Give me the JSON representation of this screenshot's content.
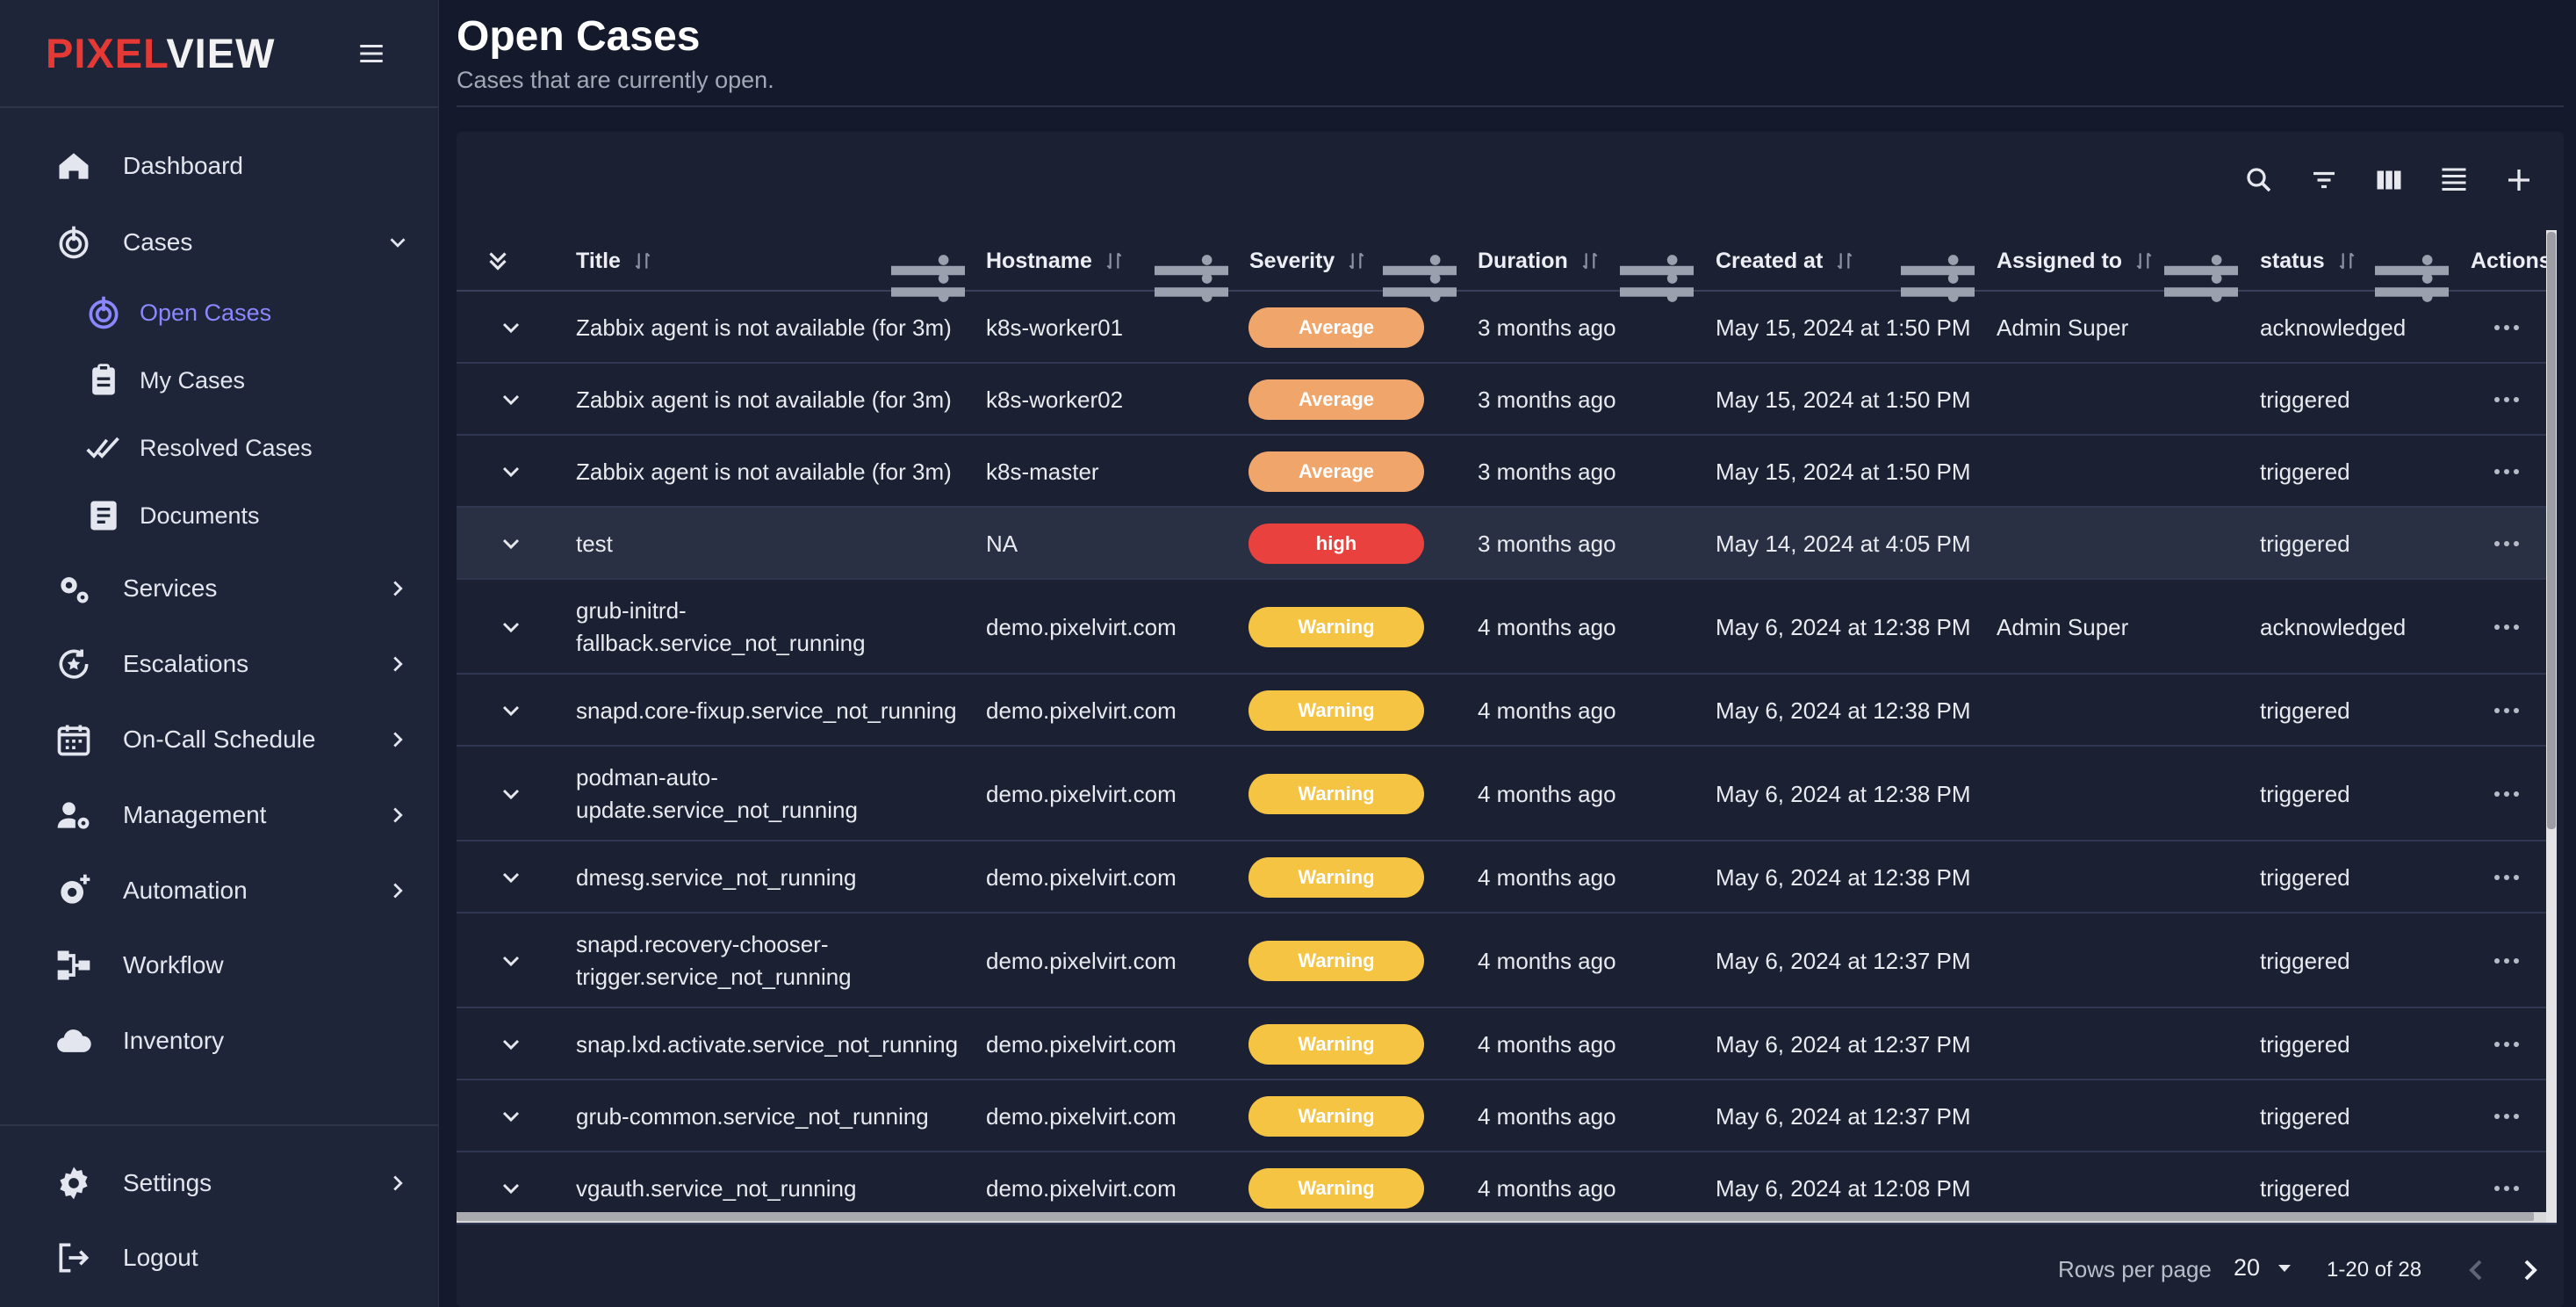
{
  "brand": {
    "part1": "PIXEL",
    "part2": "VIEW"
  },
  "sidebar": {
    "items": [
      {
        "label": "Dashboard",
        "icon": "home-icon"
      },
      {
        "label": "Cases",
        "icon": "target-icon"
      },
      {
        "label": "Services",
        "icon": "gears-icon"
      },
      {
        "label": "Escalations",
        "icon": "escalation-icon"
      },
      {
        "label": "On-Call Schedule",
        "icon": "calendar-icon"
      },
      {
        "label": "Management",
        "icon": "user-gear-icon"
      },
      {
        "label": "Automation",
        "icon": "gear-plus-icon"
      },
      {
        "label": "Workflow",
        "icon": "workflow-icon"
      },
      {
        "label": "Inventory",
        "icon": "cloud-icon"
      }
    ],
    "cases_sub": [
      {
        "label": "Open Cases",
        "icon": "target-icon",
        "active": true
      },
      {
        "label": "My Cases",
        "icon": "clipboard-icon"
      },
      {
        "label": "Resolved Cases",
        "icon": "double-check-icon"
      },
      {
        "label": "Documents",
        "icon": "document-icon"
      }
    ],
    "bottom": [
      {
        "label": "Settings",
        "icon": "gear-icon"
      },
      {
        "label": "Logout",
        "icon": "logout-icon"
      }
    ]
  },
  "header": {
    "title": "Open Cases",
    "subtitle": "Cases that are currently open."
  },
  "table": {
    "columns": [
      "Title",
      "Hostname",
      "Severity",
      "Duration",
      "Created at",
      "Assigned to",
      "status",
      "Actions"
    ],
    "rows": [
      {
        "title": "Zabbix agent is not available (for 3m)",
        "hostname": "k8s-worker01",
        "severity": "Average",
        "duration": "3 months ago",
        "created": "May 15, 2024 at 1:50 PM",
        "assigned": "Admin Super",
        "status": "acknowledged"
      },
      {
        "title": "Zabbix agent is not available (for 3m)",
        "hostname": "k8s-worker02",
        "severity": "Average",
        "duration": "3 months ago",
        "created": "May 15, 2024 at 1:50 PM",
        "assigned": "",
        "status": "triggered"
      },
      {
        "title": "Zabbix agent is not available (for 3m)",
        "hostname": "k8s-master",
        "severity": "Average",
        "duration": "3 months ago",
        "created": "May 15, 2024 at 1:50 PM",
        "assigned": "",
        "status": "triggered"
      },
      {
        "title": "test",
        "hostname": "NA",
        "severity": "high",
        "duration": "3 months ago",
        "created": "May 14, 2024 at 4:05 PM",
        "assigned": "",
        "status": "triggered"
      },
      {
        "title": "grub-initrd-fallback.service_not_running",
        "hostname": "demo.pixelvirt.com",
        "severity": "Warning",
        "duration": "4 months ago",
        "created": "May 6, 2024 at 12:38 PM",
        "assigned": "Admin Super",
        "status": "acknowledged"
      },
      {
        "title": "snapd.core-fixup.service_not_running",
        "hostname": "demo.pixelvirt.com",
        "severity": "Warning",
        "duration": "4 months ago",
        "created": "May 6, 2024 at 12:38 PM",
        "assigned": "",
        "status": "triggered"
      },
      {
        "title": "podman-auto-update.service_not_running",
        "hostname": "demo.pixelvirt.com",
        "severity": "Warning",
        "duration": "4 months ago",
        "created": "May 6, 2024 at 12:38 PM",
        "assigned": "",
        "status": "triggered"
      },
      {
        "title": "dmesg.service_not_running",
        "hostname": "demo.pixelvirt.com",
        "severity": "Warning",
        "duration": "4 months ago",
        "created": "May 6, 2024 at 12:38 PM",
        "assigned": "",
        "status": "triggered"
      },
      {
        "title": "snapd.recovery-chooser-trigger.service_not_running",
        "hostname": "demo.pixelvirt.com",
        "severity": "Warning",
        "duration": "4 months ago",
        "created": "May 6, 2024 at 12:37 PM",
        "assigned": "",
        "status": "triggered"
      },
      {
        "title": "snap.lxd.activate.service_not_running",
        "hostname": "demo.pixelvirt.com",
        "severity": "Warning",
        "duration": "4 months ago",
        "created": "May 6, 2024 at 12:37 PM",
        "assigned": "",
        "status": "triggered"
      },
      {
        "title": "grub-common.service_not_running",
        "hostname": "demo.pixelvirt.com",
        "severity": "Warning",
        "duration": "4 months ago",
        "created": "May 6, 2024 at 12:37 PM",
        "assigned": "",
        "status": "triggered"
      },
      {
        "title": "vgauth.service_not_running",
        "hostname": "demo.pixelvirt.com",
        "severity": "Warning",
        "duration": "4 months ago",
        "created": "May 6, 2024 at 12:08 PM",
        "assigned": "",
        "status": "triggered"
      }
    ]
  },
  "pagination": {
    "rows_per_page_label": "Rows per page",
    "rows_per_page": "20",
    "range": "1-20 of 28"
  },
  "colors": {
    "brand_red": "#e53935",
    "accent": "#8b87ff",
    "average": "#f0a66a",
    "high": "#e8413e",
    "warning": "#f6c443"
  }
}
